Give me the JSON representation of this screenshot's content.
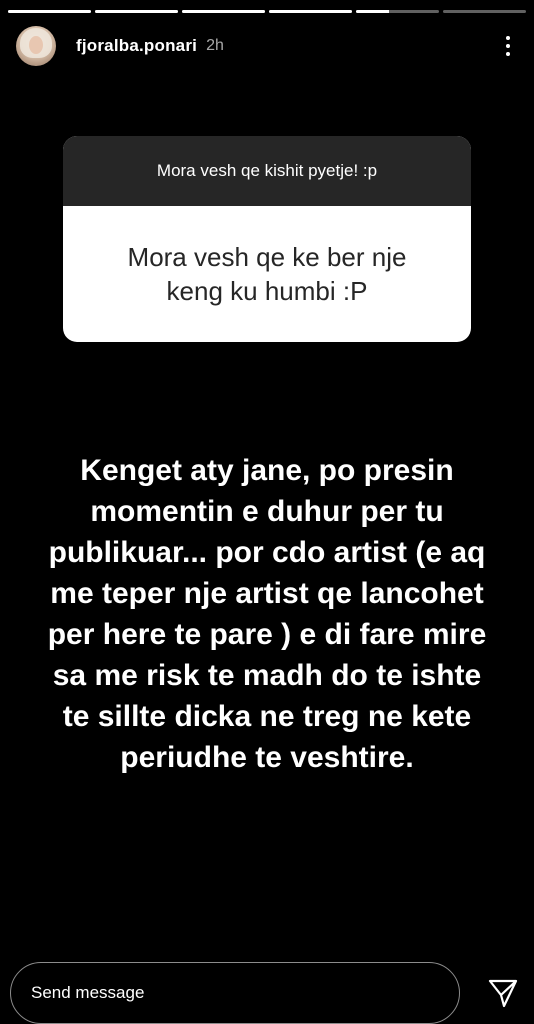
{
  "progress": {
    "segments": [
      1,
      1,
      1,
      1,
      0.4,
      0
    ]
  },
  "header": {
    "username": "fjoralba.ponari",
    "time": "2h",
    "avatar_icon": "profile-avatar",
    "more_icon": "more-vertical-icon"
  },
  "question": {
    "prompt": "Mora vesh qe kishit pyetje! :p",
    "text": "Mora vesh qe ke ber nje keng ku humbi :P"
  },
  "answer": {
    "text": "Kenget aty jane, po presin momentin e duhur per tu publikuar... por cdo artist (e aq me teper nje artist qe lancohet per here te pare ) e di fare mire sa me risk te madh do te ishte te sillte dicka ne treg ne kete periudhe te veshtire."
  },
  "footer": {
    "placeholder": "Send message",
    "send_icon": "send-paper-plane-icon"
  },
  "colors": {
    "background": "#000000",
    "question_header": "#262626",
    "question_body": "#ffffff",
    "text_dark": "#262626"
  }
}
